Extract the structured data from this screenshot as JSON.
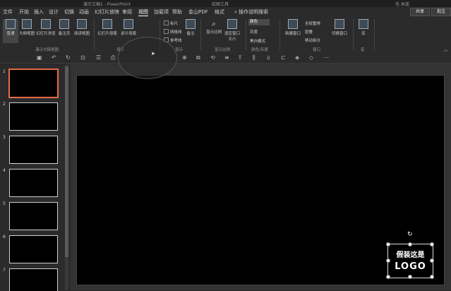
{
  "titlebar": {
    "doc_title": "演示文稿1 - PowerPoint",
    "context_tab": "绘图工具",
    "user": "毛 米遥"
  },
  "menus": [
    "文件",
    "开始",
    "插入",
    "设计",
    "切换",
    "动画",
    "幻灯片放映",
    "审阅",
    "视图",
    "加载项",
    "帮助",
    "金山PDF",
    "格式"
  ],
  "active_menu": "视图",
  "search_text": "操作说明搜索",
  "share_label": "共享",
  "comment_label": "批注",
  "ribbon": {
    "views": [
      "普通",
      "大纲视图",
      "幻灯片浏览",
      "备注页",
      "阅读视图"
    ],
    "views_group": "演示文稿视图",
    "masters": [
      "幻灯片母版",
      "讲义母版"
    ],
    "masters_group": "母版",
    "show_items": [
      "标尺",
      "网格线",
      "参考线"
    ],
    "show_group": "显示",
    "notes_label": "备注",
    "zoom_items": [
      "显示比例",
      "适应窗口大小"
    ],
    "zoom_group": "显示比例",
    "color_items": [
      "颜色",
      "灰度",
      "黑白模式"
    ],
    "color_group": "颜色/灰度",
    "window_items": [
      "新建窗口",
      "全部重排",
      "层叠",
      "移动拆分",
      "切换窗口"
    ],
    "window_group": "窗口",
    "macro_label": "宏",
    "macro_group": "宏"
  },
  "slides": [
    "1",
    "2",
    "3",
    "4",
    "5",
    "6",
    "7"
  ],
  "logo": {
    "line1": "假装这是",
    "line2": "LOGO"
  },
  "colors": {
    "accent_selected": "#e86a45",
    "background": "#2b2b2b",
    "canvas": "#000000"
  }
}
